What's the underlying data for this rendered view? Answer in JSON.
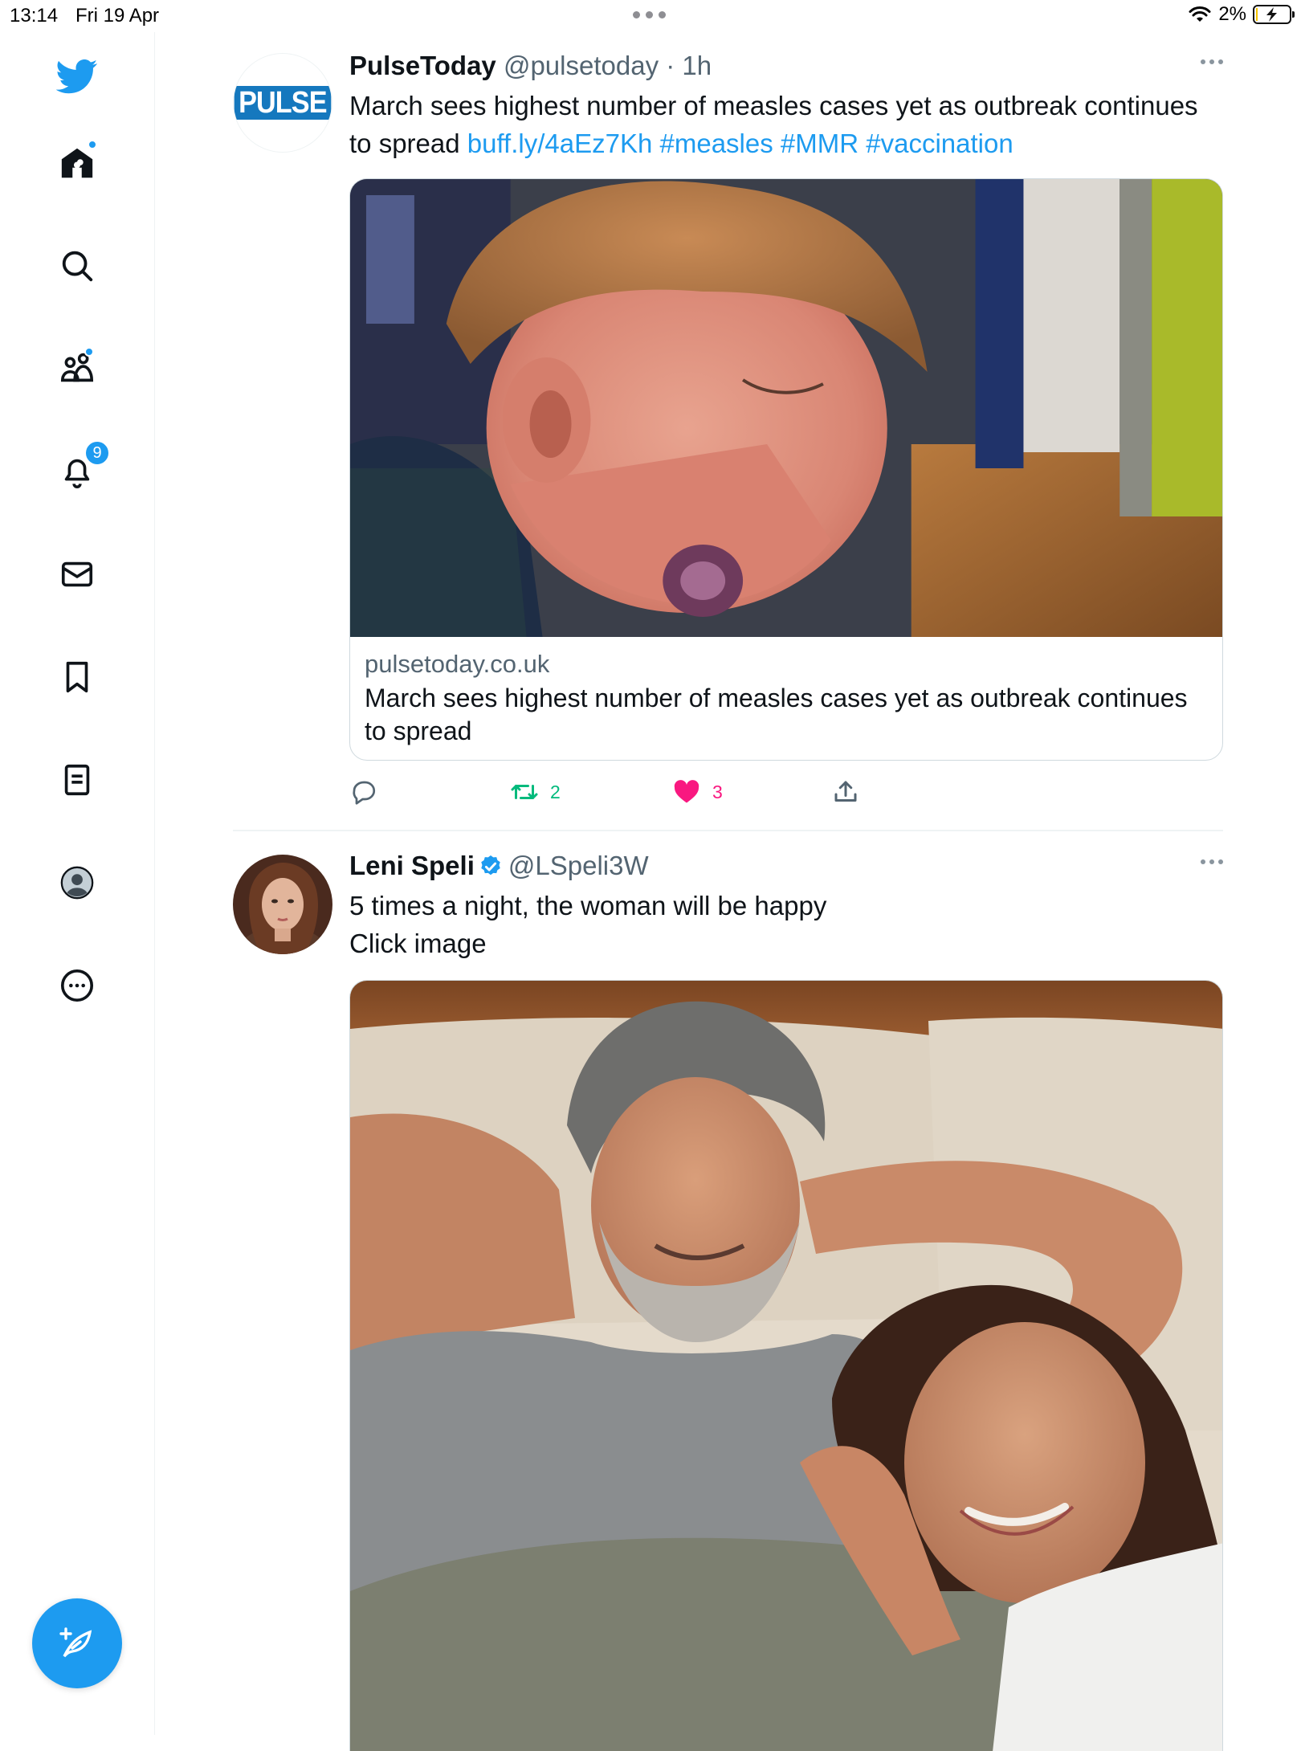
{
  "status_bar": {
    "time": "13:14",
    "date": "Fri 19 Apr",
    "battery": "2%"
  },
  "sidebar": {
    "items": [
      {
        "name": "home",
        "icon": "home-icon",
        "has_dot": true
      },
      {
        "name": "explore",
        "icon": "search-icon"
      },
      {
        "name": "communities",
        "icon": "people-icon",
        "has_dot": true
      },
      {
        "name": "notifications",
        "icon": "bell-icon",
        "badge": "9"
      },
      {
        "name": "messages",
        "icon": "envelope-icon"
      },
      {
        "name": "bookmarks",
        "icon": "bookmark-icon"
      },
      {
        "name": "lists",
        "icon": "list-icon"
      },
      {
        "name": "profile",
        "icon": "avatar-icon"
      },
      {
        "name": "more",
        "icon": "more-circle-icon"
      }
    ],
    "compose_icon": "compose-feather-icon"
  },
  "colors": {
    "accent": "#1d9bf0",
    "like": "#f91880",
    "retweet": "#00ba7c",
    "text": "#0f1419",
    "muted": "#536471"
  },
  "tweets": [
    {
      "display_name": "PulseToday",
      "handle": "@pulsetoday",
      "separator": "·",
      "time": "1h",
      "avatar_text": "PULSE",
      "text": "March sees highest number of measles cases yet as outbreak continues to spread",
      "link": "buff.ly/4aEz7Kh",
      "hashtags": [
        "#measles",
        "#MMR",
        "#vaccination"
      ],
      "card": {
        "domain": "pulsetoday.co.uk",
        "title": "March sees highest number of measles cases yet as outbreak continues to spread"
      },
      "actions": {
        "reply_count": "",
        "retweet_count": "2",
        "like_count": "3"
      }
    },
    {
      "display_name": "Leni Speli",
      "handle": "@LSpeli3W",
      "verified": true,
      "text_line1": "5 times a night, the woman will be happy",
      "text_line2": "Click image"
    }
  ]
}
